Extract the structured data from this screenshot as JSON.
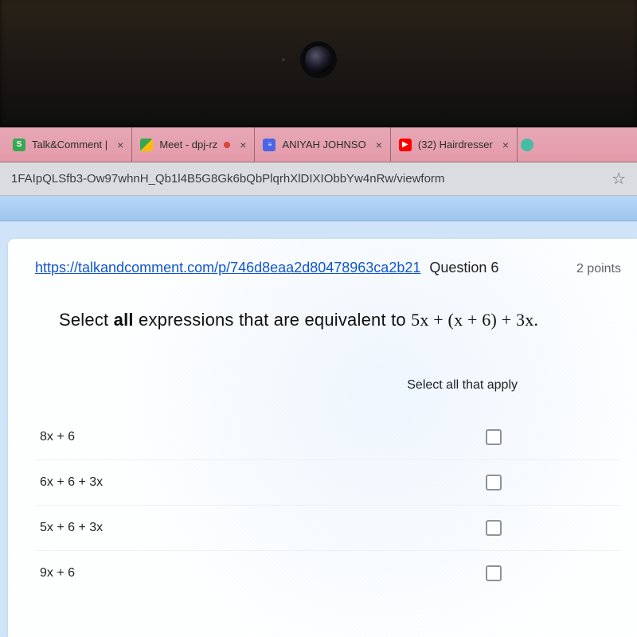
{
  "tabs": [
    {
      "title": "Talk&Comment |"
    },
    {
      "title": "Meet - dpj-rz"
    },
    {
      "title": "ANIYAH JOHNSO"
    },
    {
      "title": "(32) Hairdresser"
    }
  ],
  "url": "1FAIpQLSfb3-Ow97whnH_Qb1l4B5G8Gk6bQbPlqrhXlDIXIObbYw4nRw/viewform",
  "question": {
    "link_text": "https://talkandcomment.com/p/746d8eaa2d80478963ca2b21",
    "label": "Question 6",
    "points": "2 points",
    "prompt_prefix": "Select ",
    "prompt_bold": "all",
    "prompt_mid": " expressions that are equivalent to ",
    "expression": "5x + (x + 6) + 3x.",
    "column_header": "Select all that apply",
    "options": [
      "8x + 6",
      "6x + 6 + 3x",
      "5x + 6 + 3x",
      "9x + 6"
    ]
  }
}
